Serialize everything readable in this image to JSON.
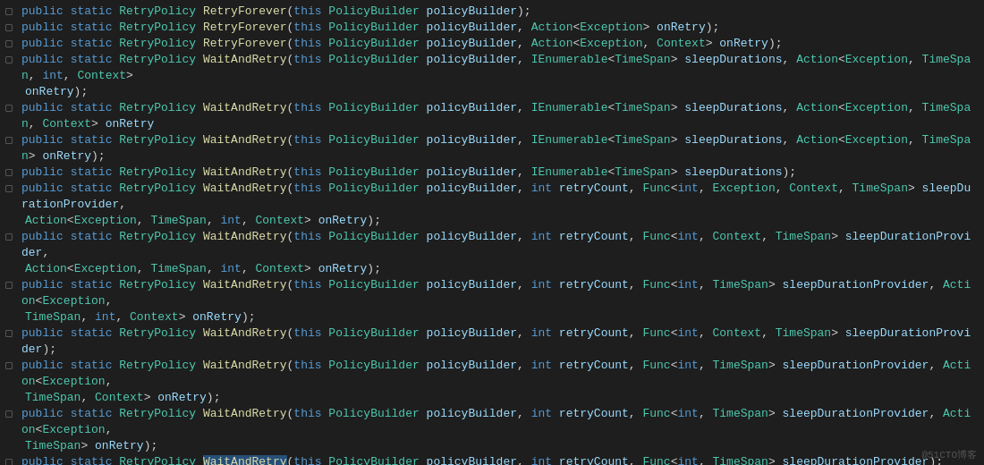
{
  "colors": {
    "background": "#1e1e1e",
    "keyword": "#569cd6",
    "type": "#4ec9b0",
    "method": "#dcdcaa",
    "param": "#9cdcfe",
    "text": "#d4d4d4",
    "highlight_bg": "#264f78"
  },
  "watermark": "@51CTO博客",
  "lines": [
    {
      "id": 1,
      "has_dot": true,
      "continued": false
    },
    {
      "id": 2,
      "has_dot": true,
      "continued": false
    },
    {
      "id": 3,
      "has_dot": true,
      "continued": false
    },
    {
      "id": 4,
      "has_dot": true,
      "continued": false
    },
    {
      "id": 5,
      "has_dot": false,
      "continued": true
    },
    {
      "id": 6,
      "has_dot": true,
      "continued": false
    },
    {
      "id": 7,
      "has_dot": true,
      "continued": false
    },
    {
      "id": 8,
      "has_dot": true,
      "continued": false
    },
    {
      "id": 9,
      "has_dot": true,
      "continued": false
    },
    {
      "id": 10,
      "has_dot": false,
      "continued": true
    },
    {
      "id": 11,
      "has_dot": true,
      "continued": false
    },
    {
      "id": 12,
      "has_dot": false,
      "continued": true
    },
    {
      "id": 13,
      "has_dot": true,
      "continued": false
    },
    {
      "id": 14,
      "has_dot": false,
      "continued": true
    },
    {
      "id": 15,
      "has_dot": true,
      "continued": false
    },
    {
      "id": 16,
      "has_dot": true,
      "continued": false
    },
    {
      "id": 17,
      "has_dot": false,
      "continued": true
    },
    {
      "id": 18,
      "has_dot": true,
      "continued": false
    },
    {
      "id": 19,
      "has_dot": false,
      "continued": true
    },
    {
      "id": 20,
      "has_dot": true,
      "continued": false
    },
    {
      "id": 21,
      "has_dot": true,
      "continued": false
    },
    {
      "id": 22,
      "has_dot": false,
      "continued": true
    },
    {
      "id": 23,
      "has_dot": true,
      "continued": false
    },
    {
      "id": 24,
      "has_dot": false,
      "continued": true
    },
    {
      "id": 25,
      "has_dot": true,
      "continued": false
    },
    {
      "id": 26,
      "has_dot": false,
      "continued": true
    },
    {
      "id": 27,
      "has_dot": true,
      "continued": false
    },
    {
      "id": 28,
      "has_dot": true,
      "continued": false
    },
    {
      "id": 29,
      "has_dot": true,
      "continued": false
    },
    {
      "id": 30,
      "has_dot": true,
      "continued": false
    },
    {
      "id": 31,
      "has_dot": false,
      "continued": true
    },
    {
      "id": 32,
      "has_dot": true,
      "continued": false
    },
    {
      "id": 33,
      "has_dot": false,
      "continued": true
    }
  ]
}
